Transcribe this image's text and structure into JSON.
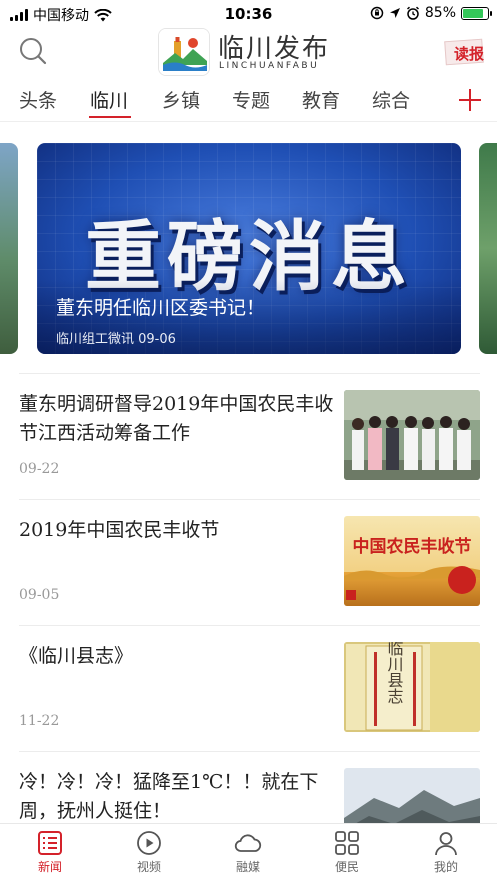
{
  "status_bar": {
    "carrier": "中国移动",
    "time": "10:36",
    "battery": "85%",
    "battery_level": 0.85
  },
  "header": {
    "app_title": "临川发布",
    "app_subtitle": "LINCHUANFABU",
    "read_label": "读报"
  },
  "tabs": [
    {
      "label": "头条"
    },
    {
      "label": "临川"
    },
    {
      "label": "乡镇"
    },
    {
      "label": "专题"
    },
    {
      "label": "教育"
    },
    {
      "label": "综合"
    }
  ],
  "active_tab": "临川",
  "banner": {
    "headline": "重磅消息",
    "title": "董东明任临川区委书记！",
    "meta": "临川组工微讯 09-06"
  },
  "news": [
    {
      "title": "董东明调研督导2019年中国农民丰收节江西活动筹备工作",
      "date": "09-22",
      "thumb": "officials-photo"
    },
    {
      "title": "2019年中国农民丰收节",
      "date": "09-05",
      "thumb": "harvest-festival-poster",
      "thumb_text": "中国农民丰收节"
    },
    {
      "title": "《临川县志》",
      "date": "11-22",
      "thumb": "county-annals-cover",
      "thumb_text": "临川县志"
    },
    {
      "title": "冷！冷！冷！猛降至1℃！！就在下周，抚州人挺住！",
      "date": "",
      "thumb": "mountain-photo"
    }
  ],
  "bottom_nav": [
    {
      "label": "新闻",
      "icon": "news-list-icon",
      "active": true
    },
    {
      "label": "视频",
      "icon": "play-icon",
      "active": false
    },
    {
      "label": "融媒",
      "icon": "cloud-icon",
      "active": false
    },
    {
      "label": "便民",
      "icon": "grid-icon",
      "active": false
    },
    {
      "label": "我的",
      "icon": "user-icon",
      "active": false
    }
  ],
  "colors": {
    "accent": "#d4222a",
    "text": "#222222",
    "muted": "#999999"
  }
}
